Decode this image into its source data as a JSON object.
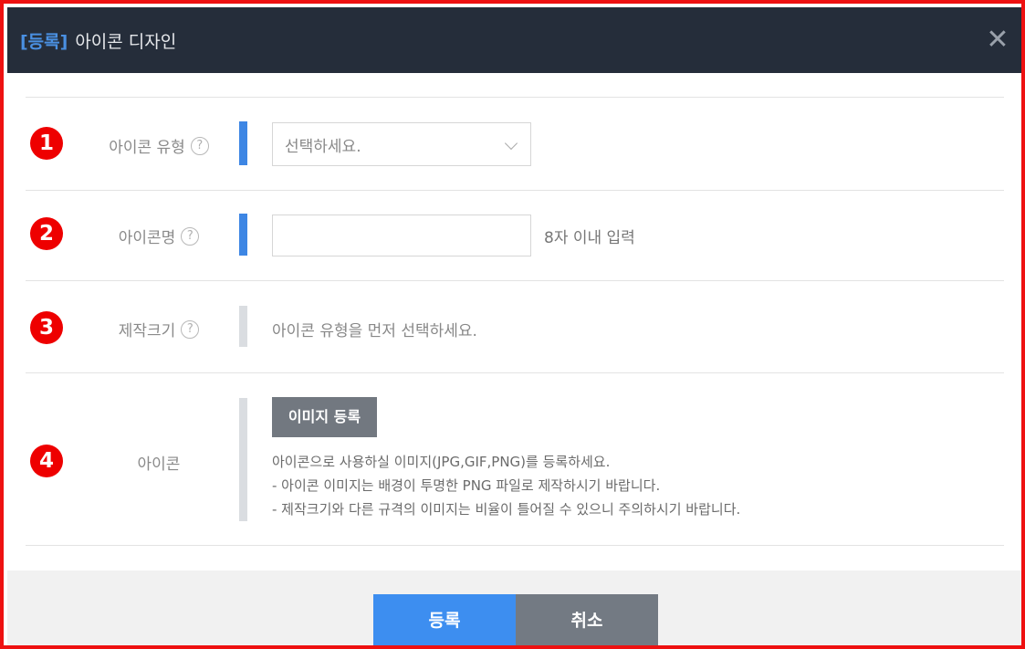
{
  "header": {
    "tag": "[등록]",
    "title": "아이콘 디자인",
    "close_symbol": "✕"
  },
  "fields": {
    "icon_type": {
      "badge": "1",
      "label": "아이콘 유형",
      "select_value": "선택하세요.",
      "help_symbol": "?"
    },
    "icon_name": {
      "badge": "2",
      "label": "아이콘명",
      "value": "",
      "hint": "8자 이내 입력",
      "help_symbol": "?"
    },
    "size": {
      "badge": "3",
      "label": "제작크기",
      "text": "아이콘 유형을 먼저 선택하세요.",
      "help_symbol": "?"
    },
    "icon": {
      "badge": "4",
      "label": "아이콘",
      "upload_button": "이미지 등록",
      "desc_lines": [
        "아이콘으로 사용하실 이미지(JPG,GIF,PNG)를 등록하세요.",
        "- 아이콘 이미지는 배경이 투명한 PNG 파일로 제작하시기 바랍니다.",
        "- 제작크기와 다른 규격의 이미지는 비율이 틀어질 수 있으니 주의하시기 바랍니다."
      ]
    }
  },
  "footer": {
    "submit_label": "등록",
    "cancel_label": "취소"
  },
  "colors": {
    "accent": "#3d8ef0",
    "header_bg": "#252d3a",
    "required_bar": "#3d86e4",
    "badge": "#ee0000"
  },
  "icons": {
    "close": "close-icon",
    "help": "help-icon",
    "select_arrow": "chevron-down-icon"
  }
}
